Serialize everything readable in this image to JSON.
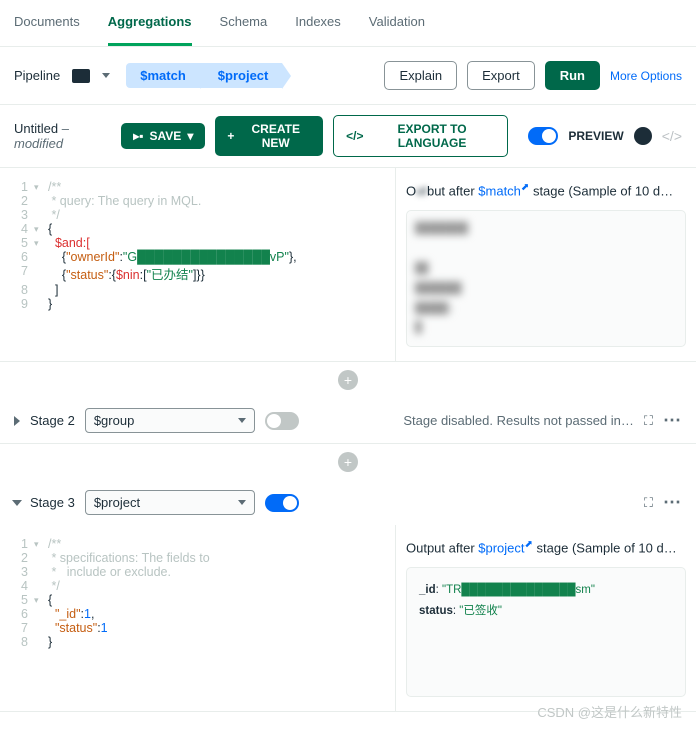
{
  "tabs": {
    "documents": "Documents",
    "aggregations": "Aggregations",
    "schema": "Schema",
    "indexes": "Indexes",
    "validation": "Validation"
  },
  "toolbar": {
    "pipeline": "Pipeline",
    "stage1": "$match",
    "stage2": "$project",
    "explain": "Explain",
    "export": "Export",
    "run": "Run",
    "more": "More Options"
  },
  "bar2": {
    "filename": "Untitled",
    "modified": "– modified",
    "save": "SAVE",
    "create": "CREATE NEW",
    "exportlang": "EXPORT TO LANGUAGE",
    "preview": "PREVIEW"
  },
  "stage1": {
    "code": {
      "l1": "/**",
      "l2": " * query: The query in MQL.",
      "l3": " */",
      "l4": "{",
      "l5": "  $and:[",
      "l6a": "    {",
      "l6k": "\"ownerId\"",
      "l6c": ":",
      "l6v": "\"G███████████████vP\"",
      "l6e": "},",
      "l7a": "    {",
      "l7k": "\"status\"",
      "l7c": ":{",
      "l7o": "$nin",
      "l7d": ":[",
      "l7v": "\"已办结\"",
      "l7e": "]}}",
      "l8": "  ]",
      "l9": "}"
    },
    "output": {
      "prefix": "O",
      "mid": "but after ",
      "stage": "$match",
      "suffix": " stage (Sample of 10 d…"
    }
  },
  "stage2": {
    "label": "Stage 2",
    "op": "$group",
    "msg": "Stage disabled. Results not passed in…"
  },
  "stage3": {
    "label": "Stage 3",
    "op": "$project",
    "code": {
      "l1": "/**",
      "l2": " * specifications: The fields to",
      "l3": " *   include or exclude.",
      "l4": " */",
      "l5": "{",
      "l6k": "\"_id\"",
      "l6c": ":",
      "l6v": "1",
      "l6e": ",",
      "l7k": "\"status\"",
      "l7c": ":",
      "l7v": "1",
      "l8": "}"
    },
    "output": {
      "prefix": "Output after ",
      "stage": "$project",
      "suffix": " stage (Sample of 10 d…",
      "doc": {
        "idk": "_id",
        "idc": ": ",
        "idv": "\"TR██████████████sm\"",
        "stk": "status",
        "stc": ": ",
        "stv": "\"已签收\""
      }
    }
  },
  "watermark": "CSDN @这是什么新特性"
}
